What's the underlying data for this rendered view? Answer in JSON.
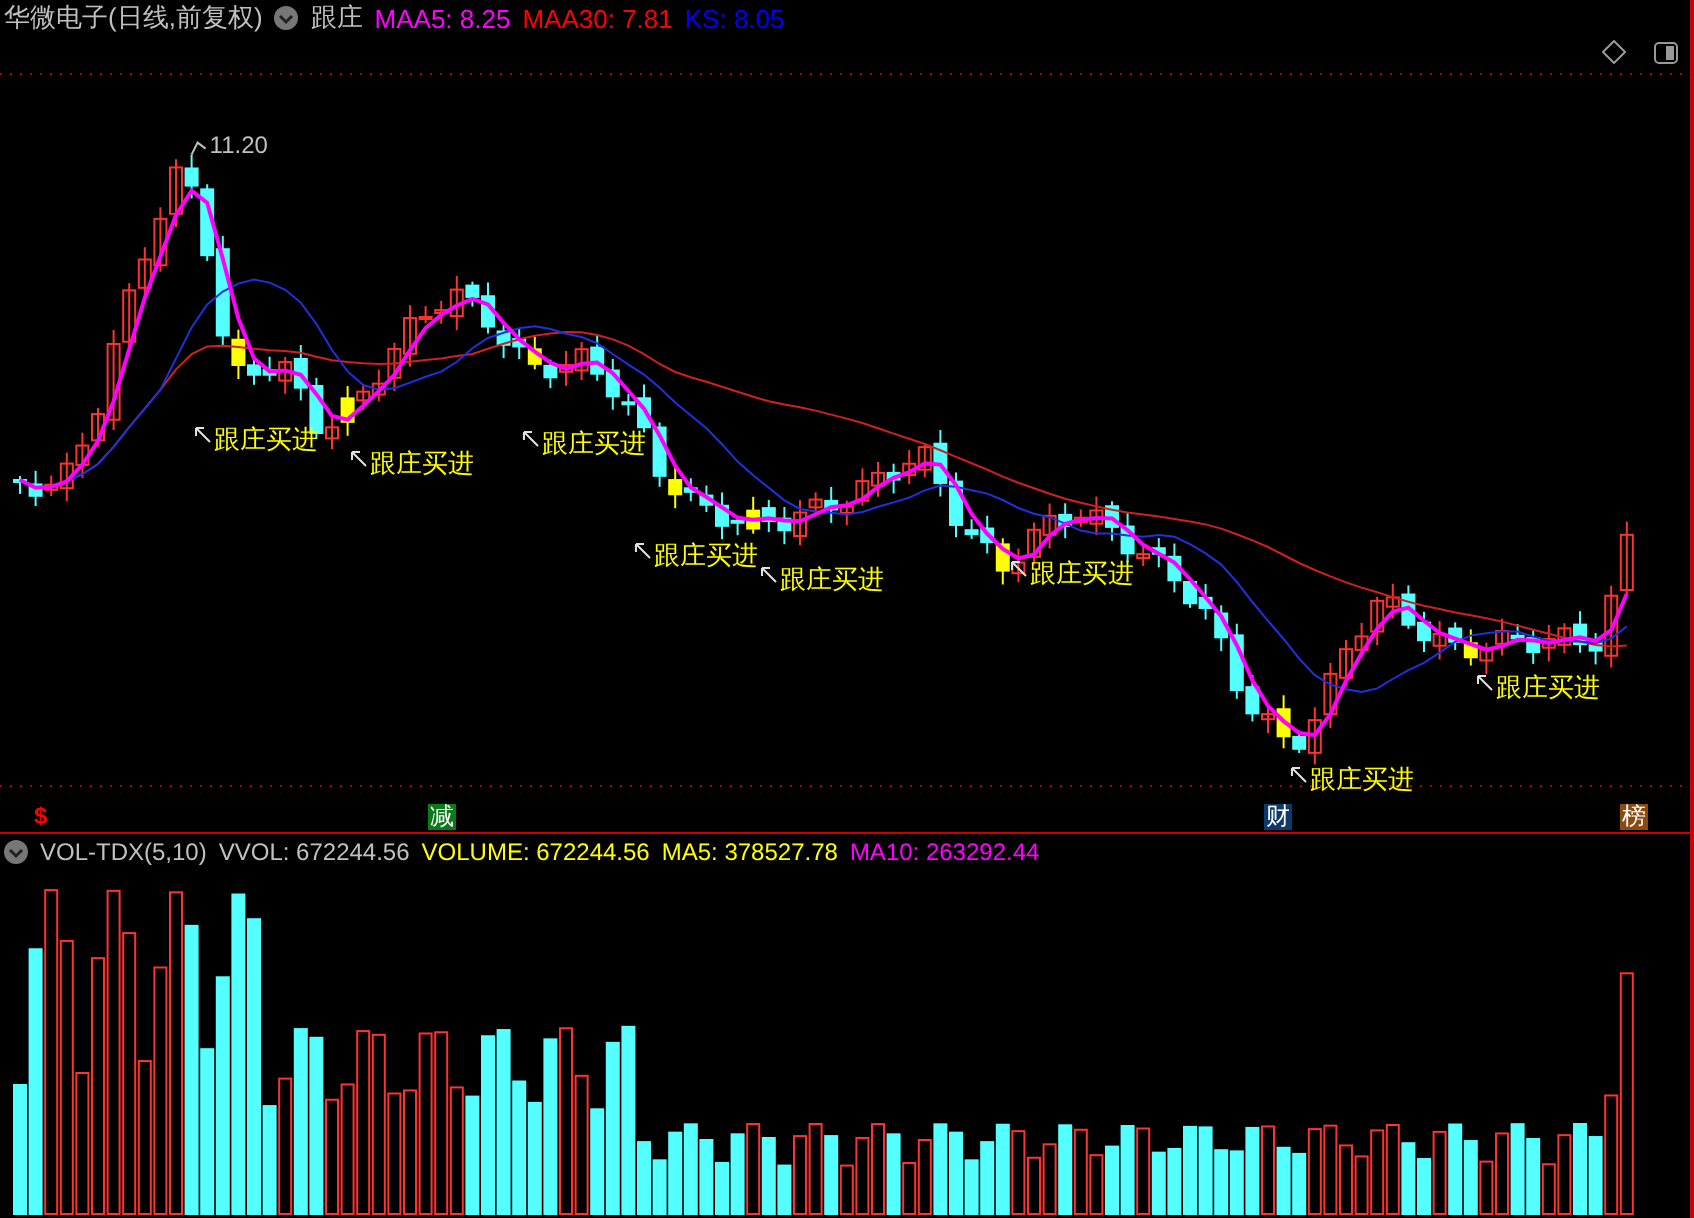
{
  "header": {
    "title": "华微电子(日线,前复权)",
    "indicator": "跟庄",
    "values": [
      {
        "label": "MAA5: 8.25",
        "color": "#ff00ff"
      },
      {
        "label": "MAA30: 7.81",
        "color": "#ff0000"
      },
      {
        "label": "KS: 8.05",
        "color": "#0000ff"
      }
    ]
  },
  "price_chart": {
    "high_label": "11.20",
    "signals": [
      {
        "text": "跟庄买进"
      },
      {
        "text": "跟庄买进"
      },
      {
        "text": "跟庄买进"
      },
      {
        "text": "跟庄买进"
      },
      {
        "text": "跟庄买进"
      },
      {
        "text": "跟庄买进"
      },
      {
        "text": "跟庄买进"
      },
      {
        "text": "跟庄买进"
      }
    ],
    "markers": [
      {
        "text": "$",
        "kind": "dividend"
      },
      {
        "text": "减",
        "kind": "reduce"
      },
      {
        "text": "财",
        "kind": "finance"
      },
      {
        "text": "榜",
        "kind": "list"
      }
    ]
  },
  "volume_panel": {
    "title": "VOL-TDX(5,10)",
    "values": [
      {
        "label": "VVOL: 672244.56",
        "color": "#c0c0c0"
      },
      {
        "label": "VOLUME: 672244.56",
        "color": "#ffff00"
      },
      {
        "label": "MA5: 378527.78",
        "color": "#ffff00"
      },
      {
        "label": "MA10: 263292.44",
        "color": "#ff00ff"
      }
    ]
  }
}
